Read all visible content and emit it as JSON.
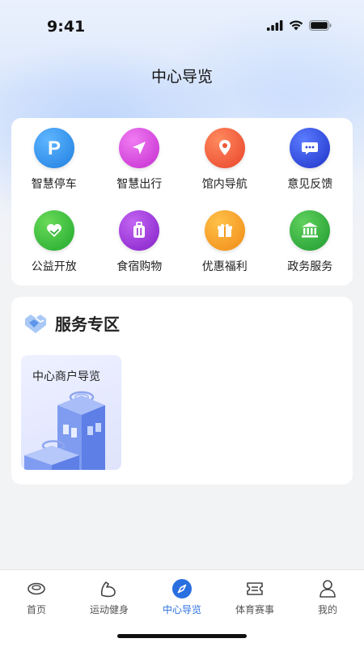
{
  "status_bar": {
    "time": "9:41"
  },
  "header": {
    "title": "中心导览"
  },
  "grid": {
    "items": [
      {
        "label": "智慧停车",
        "icon": "parking-icon",
        "color": "#1e88e5"
      },
      {
        "label": "智慧出行",
        "icon": "navigation-arrow-icon",
        "color": "#d63ad8"
      },
      {
        "label": "馆内导航",
        "icon": "location-pin-icon",
        "color": "#f0502f"
      },
      {
        "label": "意见反馈",
        "icon": "chat-bubble-icon",
        "color": "#2740d8"
      },
      {
        "label": "公益开放",
        "icon": "heart-hand-icon",
        "color": "#31b83a"
      },
      {
        "label": "食宿购物",
        "icon": "luggage-icon",
        "color": "#9a2fd6"
      },
      {
        "label": "优惠福利",
        "icon": "gift-icon",
        "color": "#f39b1d"
      },
      {
        "label": "政务服务",
        "icon": "government-building-icon",
        "color": "#2fa83f"
      }
    ]
  },
  "service_zone": {
    "title": "服务专区",
    "tiles": [
      {
        "label": "中心商户导览"
      }
    ]
  },
  "tab_bar": {
    "tabs": [
      {
        "label": "首页",
        "icon": "home-stadium-icon"
      },
      {
        "label": "运动健身",
        "icon": "fitness-arm-icon"
      },
      {
        "label": "中心导览",
        "icon": "compass-icon",
        "active": true
      },
      {
        "label": "体育赛事",
        "icon": "ticket-icon"
      },
      {
        "label": "我的",
        "icon": "profile-icon"
      }
    ],
    "active_color": "#2a6fe0"
  }
}
